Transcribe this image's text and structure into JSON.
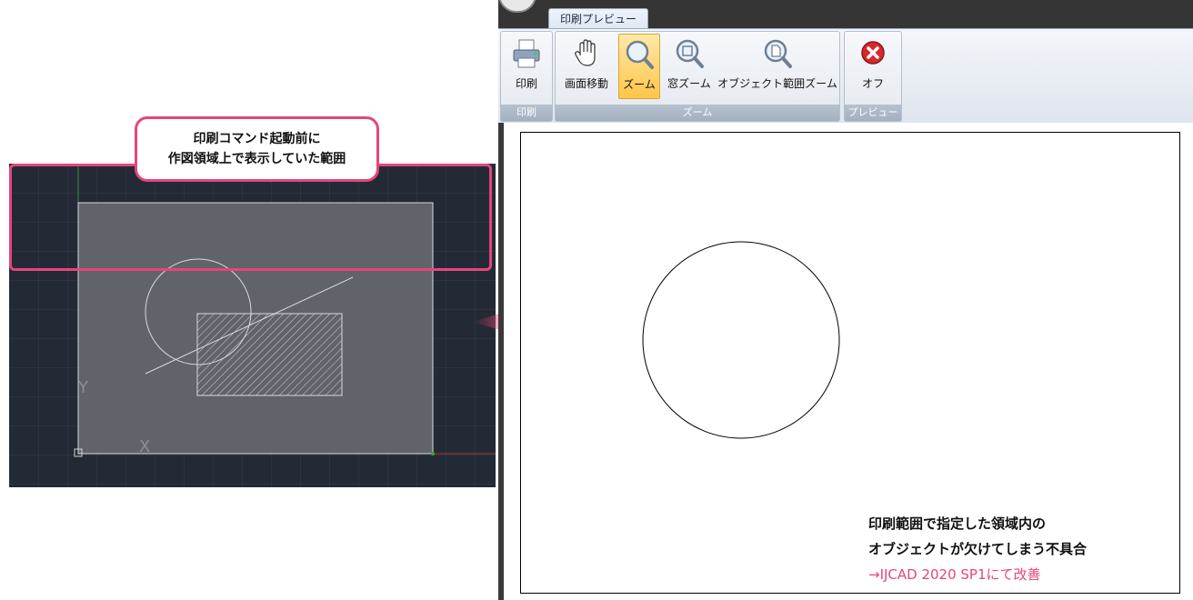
{
  "annotation": {
    "callout_line1": "印刷コマンド起動前に",
    "callout_line2": "作図領域上で表示していた範囲",
    "note_line1": "印刷範囲で指定した領域内の",
    "note_line2": "オブジェクトが欠けてしまう不具合",
    "note_line3": "→IJCAD 2020 SP1にて改善",
    "accent_color": "#e5457c"
  },
  "cad_view": {
    "y_axis_label": "Y",
    "x_axis_label": "X"
  },
  "app": {
    "tab": "印刷プレビュー",
    "groups": [
      {
        "label": "印刷",
        "buttons": [
          {
            "label": "印刷",
            "icon": "printer-icon"
          }
        ]
      },
      {
        "label": "ズーム",
        "buttons": [
          {
            "label": "画面移動",
            "icon": "hand-pan-icon"
          },
          {
            "label": "ズーム",
            "icon": "magnifier-icon",
            "active": true
          },
          {
            "label": "窓ズーム",
            "icon": "window-zoom-icon"
          },
          {
            "label": "オブジェクト範囲ズーム",
            "icon": "extents-zoom-icon"
          }
        ]
      },
      {
        "label": "プレビュー",
        "buttons": [
          {
            "label": "オフ",
            "icon": "close-red-icon"
          }
        ]
      }
    ]
  }
}
